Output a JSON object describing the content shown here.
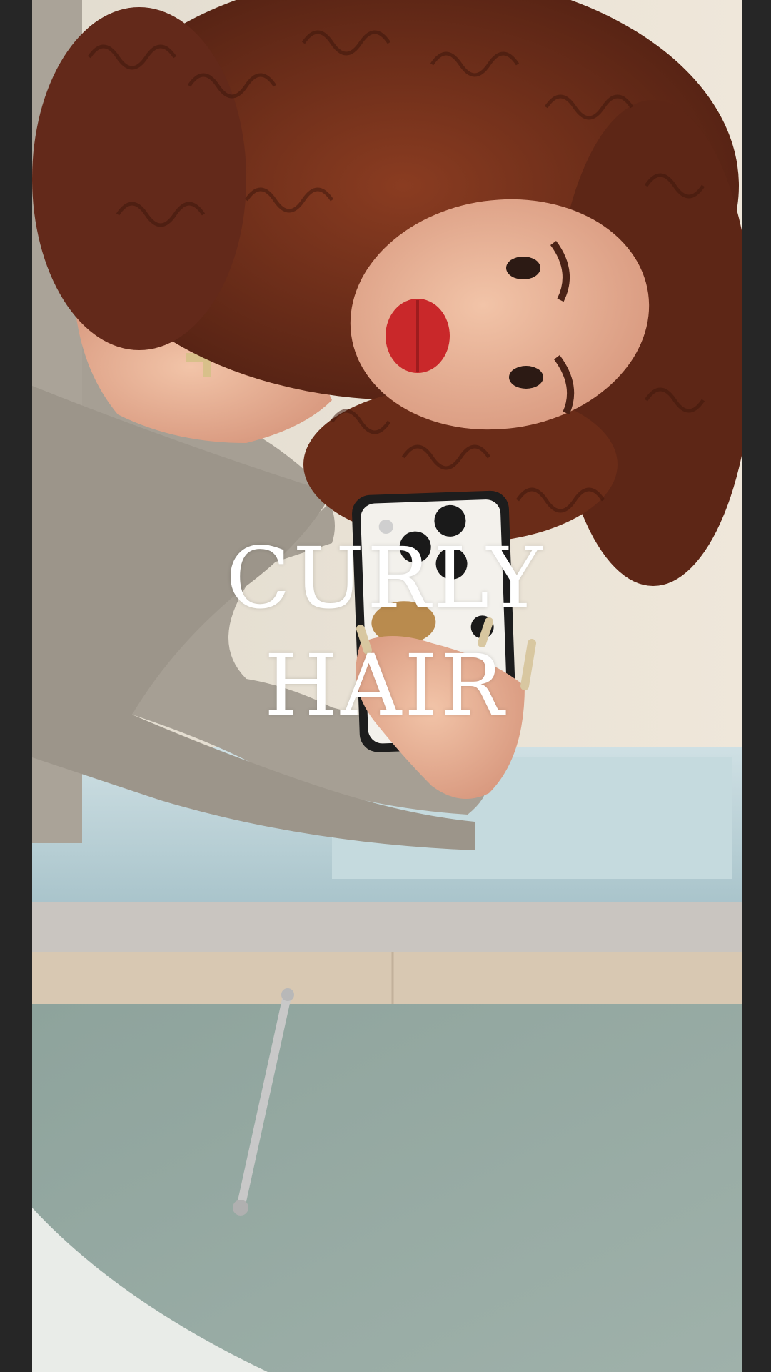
{
  "overlay": {
    "line_1": "CURLY",
    "line_2": "HAIR"
  },
  "colors": {
    "letterbox": "#262626",
    "caption_text": "#ffffff",
    "hair": "#6b2d1a",
    "sweater": "#a59d92",
    "tub": "#b8cfd6",
    "counter": "#8fa39d"
  }
}
